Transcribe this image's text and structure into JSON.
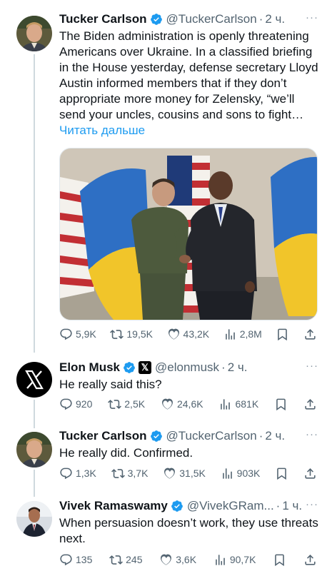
{
  "tweets": [
    {
      "name": "Tucker Carlson",
      "handle": "@TuckerCarlson",
      "time": "2 ч.",
      "text": "The Biden administration is openly threatening Americans over Ukraine. In a classified briefing in the House yesterday, defense secretary Lloyd Austin informed members that if they don’t appropriate more money for Zelensky, “we’ll send your uncles, cousins and sons to fight…",
      "read_more": "Читать дальше",
      "replies": "5,9K",
      "retweets": "19,5K",
      "likes": "43,2K",
      "views": "2,8M"
    },
    {
      "name": "Elon Musk",
      "affiliation": "𝕏",
      "handle": "@elonmusk",
      "time": "2 ч.",
      "text": "He really said this?",
      "replies": "920",
      "retweets": "2,5K",
      "likes": "24,6K",
      "views": "681K"
    },
    {
      "name": "Tucker Carlson",
      "handle": "@TuckerCarlson",
      "time": "2 ч.",
      "text": "He really did. Confirmed.",
      "replies": "1,3K",
      "retweets": "3,7K",
      "likes": "31,5K",
      "views": "903K"
    },
    {
      "name": "Vivek Ramaswamy",
      "handle": "@VivekGRam...",
      "time": "1 ч.",
      "text": "When persuasion doesn’t work, they use threats next.",
      "replies": "135",
      "retweets": "245",
      "likes": "3,6K",
      "views": "90,7K"
    }
  ],
  "dot": "·",
  "more": "···",
  "colors": {
    "verified": "#1d9bf0",
    "link": "#1d9bf0",
    "muted": "#536471"
  },
  "icons": [
    "verified-badge-icon",
    "reply-icon",
    "retweet-icon",
    "like-icon",
    "views-icon",
    "bookmark-icon",
    "share-icon",
    "x-logo-icon",
    "more-icon"
  ]
}
